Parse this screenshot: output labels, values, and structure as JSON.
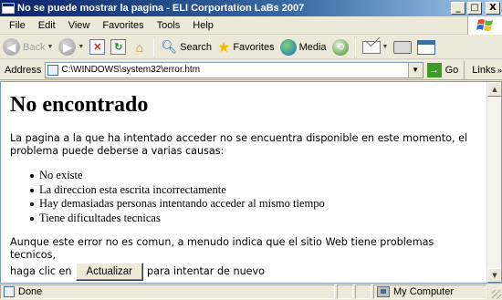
{
  "window": {
    "title": "No se puede mostrar la pagina - ELI Corportation LaBs 2007",
    "minimize": "_",
    "maximize": "□",
    "close": "X"
  },
  "menu": {
    "items": [
      "File",
      "Edit",
      "View",
      "Favorites",
      "Tools",
      "Help"
    ]
  },
  "toolbar": {
    "back_label": "Back",
    "search_label": "Search",
    "favorites_label": "Favorites",
    "media_label": "Media"
  },
  "address": {
    "label": "Address",
    "url": "C:\\WINDOWS\\system32\\error.htm",
    "go_label": "Go",
    "links_label": "Links"
  },
  "page": {
    "title": "No encontrado",
    "intro": "La pagina a la que ha intentado acceder no se encuentra disponible en este momento, el problema puede deberse a varias causas:",
    "causes": [
      "No existe",
      "La direccion esta escrita incorrectamente",
      "Hay demasiadas personas intentando acceder al mismo tiempo",
      "Tiene dificultades tecnicas"
    ],
    "footer_line1": "Aunque este error no es comun, a menudo indica que el sitio Web tiene problemas tecnicos,",
    "footer_prefix": "haga clic en",
    "refresh_button": "Actualizar",
    "footer_suffix": "para intentar de nuevo"
  },
  "status": {
    "text": "Done",
    "zone": "My Computer"
  }
}
